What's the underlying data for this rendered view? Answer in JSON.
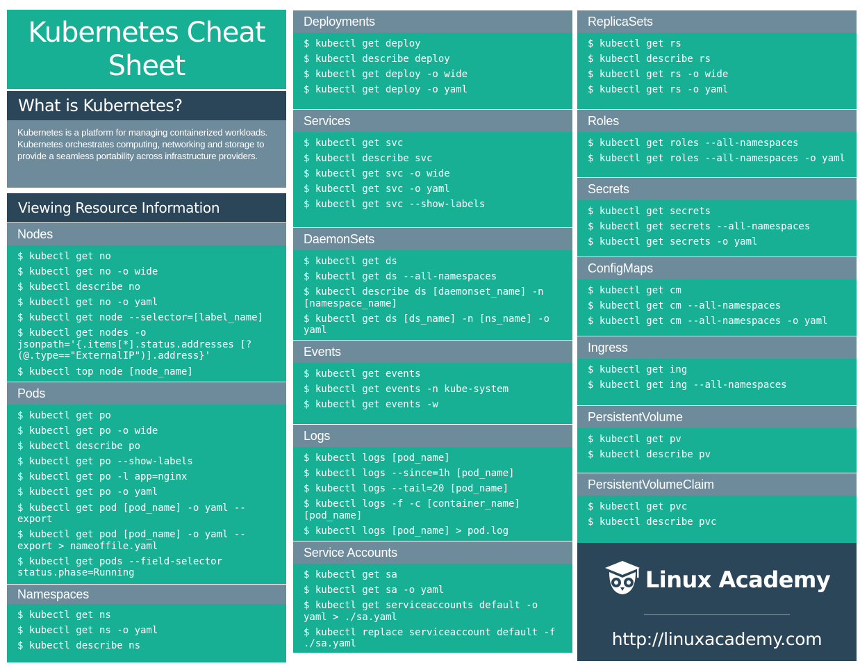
{
  "title": "Kubernetes Cheat Sheet",
  "intro": {
    "heading": "What is Kubernetes?",
    "body": "Kubernetes is a platform for managing containerized workloads. Kubernetes orchestrates computing, networking and storage to provide a seamless portability across infrastructure providers."
  },
  "viewing_heading": "Viewing Resource Information",
  "sections": {
    "nodes": {
      "heading": "Nodes",
      "commands": [
        "$ kubectl get no",
        "$ kubectl get no -o wide",
        "$ kubectl describe no",
        "$ kubectl get no -o yaml",
        "$ kubectl get node --selector=[label_name]",
        "$ kubectl get nodes -o jsonpath='{.items[*].status.addresses [?(@.type==\"ExternalIP\")].address}'",
        "$ kubectl top node [node_name]"
      ]
    },
    "pods": {
      "heading": "Pods",
      "commands": [
        "$ kubectl get po",
        "$ kubectl get po -o wide",
        "$ kubectl describe po",
        "$ kubectl get po --show-labels",
        "$ kubectl get po -l app=nginx",
        "$ kubectl get po -o yaml",
        "$ kubectl get pod [pod_name] -o yaml --export",
        "$ kubectl get pod [pod_name] -o yaml --export > nameoffile.yaml",
        "$ kubectl get pods --field-selector status.phase=Running"
      ]
    },
    "namespaces": {
      "heading": "Namespaces",
      "commands": [
        "$ kubectl get ns",
        "$ kubectl get ns -o yaml",
        "$ kubectl describe ns"
      ]
    },
    "deployments": {
      "heading": "Deployments",
      "commands": [
        "$ kubectl get deploy",
        "$ kubectl describe deploy",
        "$ kubectl get deploy -o wide",
        "$ kubectl get deploy -o yaml"
      ]
    },
    "services": {
      "heading": "Services",
      "commands": [
        "$ kubectl get svc",
        "$ kubectl describe svc",
        "$ kubectl get svc -o wide",
        "$ kubectl get svc -o yaml",
        "$ kubectl get svc --show-labels"
      ]
    },
    "daemonsets": {
      "heading": "DaemonSets",
      "commands": [
        "$ kubectl get ds",
        "$ kubectl get ds --all-namespaces",
        "$ kubectl describe ds [daemonset_name] -n [namespace_name]",
        "$ kubectl get ds [ds_name] -n [ns_name] -o yaml"
      ]
    },
    "events": {
      "heading": "Events",
      "commands": [
        "$ kubectl get events",
        "$ kubectl get events -n kube-system",
        "$ kubectl get events -w"
      ]
    },
    "logs": {
      "heading": "Logs",
      "commands": [
        "$ kubectl logs [pod_name]",
        "$ kubectl logs --since=1h [pod_name]",
        "$ kubectl logs --tail=20 [pod_name]",
        "$ kubectl logs -f -c [container_name] [pod_name]",
        "$ kubectl logs [pod_name] > pod.log"
      ]
    },
    "service_accounts": {
      "heading": "Service Accounts",
      "commands": [
        "$ kubectl get sa",
        "$ kubectl get sa -o yaml",
        "$ kubectl get serviceaccounts default -o yaml > ./sa.yaml",
        "$ kubectl replace serviceaccount default -f ./sa.yaml"
      ]
    },
    "replicasets": {
      "heading": "ReplicaSets",
      "commands": [
        "$ kubectl get rs",
        "$ kubectl describe rs",
        "$ kubectl get rs -o wide",
        "$ kubectl get rs -o yaml"
      ]
    },
    "roles": {
      "heading": "Roles",
      "commands": [
        "$ kubectl get roles --all-namespaces",
        "$ kubectl get roles --all-namespaces -o yaml"
      ]
    },
    "secrets": {
      "heading": "Secrets",
      "commands": [
        "$ kubectl get secrets",
        "$ kubectl get secrets --all-namespaces",
        "$ kubectl get secrets -o yaml"
      ]
    },
    "configmaps": {
      "heading": "ConfigMaps",
      "commands": [
        "$ kubectl get cm",
        "$ kubectl get cm --all-namespaces",
        "$ kubectl get cm --all-namespaces -o yaml"
      ]
    },
    "ingress": {
      "heading": "Ingress",
      "commands": [
        "$ kubectl get ing",
        "$ kubectl get ing --all-namespaces"
      ]
    },
    "persistent_volume": {
      "heading": "PersistentVolume",
      "commands": [
        "$ kubectl get pv",
        "$ kubectl describe pv"
      ]
    },
    "persistent_volume_claim": {
      "heading": "PersistentVolumeClaim",
      "commands": [
        "$ kubectl get pvc",
        "$ kubectl describe pvc"
      ]
    }
  },
  "brand": {
    "logo_icon": "owl-graduation-cap-icon",
    "name": "Linux Academy",
    "url": "http://linuxacademy.com"
  },
  "colors": {
    "teal": "#18b094",
    "slate": "#6e8b9b",
    "navy": "#2c4659"
  }
}
